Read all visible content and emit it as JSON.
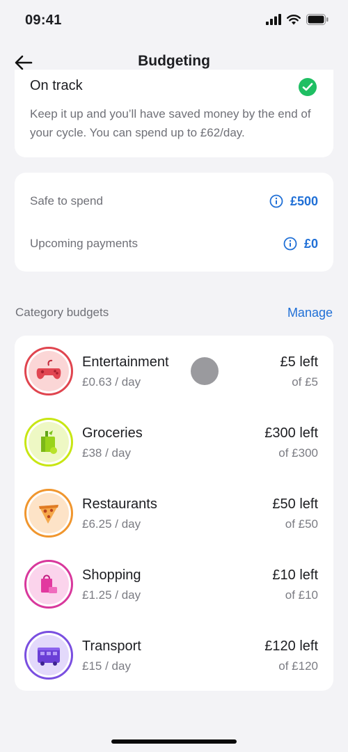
{
  "status_bar": {
    "time": "09:41"
  },
  "nav": {
    "title": "Budgeting"
  },
  "status_card": {
    "title": "On track",
    "description": "Keep it up and you’ll have saved money by the end of your cycle. You can spend up to £62/day."
  },
  "spend_card": {
    "safe_label": "Safe to spend",
    "safe_value": "£500",
    "upcoming_label": "Upcoming payments",
    "upcoming_value": "£0"
  },
  "categories_section": {
    "title": "Category budgets",
    "manage_label": "Manage"
  },
  "categories": [
    {
      "name": "Entertainment",
      "rate": "£0.63 / day",
      "left": "£5 left",
      "of": "of £5",
      "icon": "game-controller-icon",
      "ring_color": "#e0454f",
      "bg_color": "#fbd6d6"
    },
    {
      "name": "Groceries",
      "rate": "£38 / day",
      "left": "£300 left",
      "of": "of £300",
      "icon": "grocery-bag-icon",
      "ring_color": "#c8e614",
      "bg_color": "#eef8c4"
    },
    {
      "name": "Restaurants",
      "rate": "£6.25 / day",
      "left": "£50 left",
      "of": "of £50",
      "icon": "pizza-slice-icon",
      "ring_color": "#f0962e",
      "bg_color": "#fde3c7"
    },
    {
      "name": "Shopping",
      "rate": "£1.25 / day",
      "left": "£10 left",
      "of": "of £10",
      "icon": "shopping-bag-icon",
      "ring_color": "#d8389c",
      "bg_color": "#fbd4ec"
    },
    {
      "name": "Transport",
      "rate": "£15 / day",
      "left": "£120 left",
      "of": "of £120",
      "icon": "bus-icon",
      "ring_color": "#7a4fe0",
      "bg_color": "#e3d9fb"
    }
  ]
}
